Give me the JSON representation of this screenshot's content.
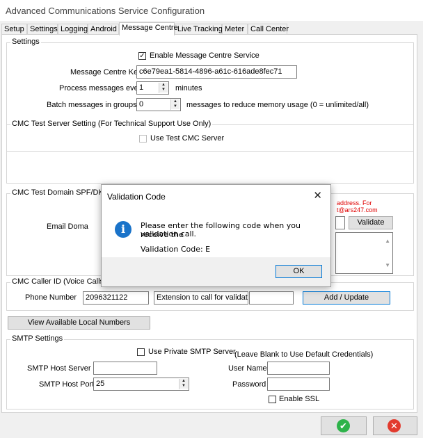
{
  "window": {
    "title": "Advanced Communications Service Configuration"
  },
  "tabs": [
    "Setup",
    "Settings",
    "Logging",
    "Android",
    "Message Centre",
    "Live Tracking",
    "Meter",
    "Call Center"
  ],
  "settings": {
    "title": "Settings",
    "enable_label": "Enable Message Centre Service",
    "enable_checked": true,
    "key_label": "Message Centre Key",
    "key_value": "c6e79ea1-5814-4896-a61c-616ade8fec71",
    "process_label": "Process messages every",
    "process_value": "1",
    "process_unit": "minutes",
    "batch_label": "Batch messages in groups of",
    "batch_value": "0",
    "batch_hint": "messages to reduce memory usage (0 = unlimited/all)"
  },
  "cmc_test_server": {
    "title": "CMC Test Server Setting (For Technical Support Use Only)",
    "use_test_label": "Use Test CMC Server"
  },
  "cmc_domain": {
    "title": "CMC Test Domain SPF/DKIM",
    "email_label": "Email Doma",
    "warn_line1": "address. For",
    "warn_line2": "t@ars247.com",
    "validate_label": "Validate"
  },
  "caller_id": {
    "title": "CMC Caller ID (Voice Calls Onl",
    "phone_label": "Phone Number",
    "phone_value": "2096321122",
    "extension_label": "Extension to call for validation",
    "add_update_label": "Add / Update"
  },
  "view_numbers_label": "View Available Local Numbers",
  "smtp": {
    "title": "SMTP Settings",
    "private_label": "Use Private SMTP Server",
    "leave_blank": "(Leave Blank to Use Default Credentials)",
    "host_label": "SMTP Host Server",
    "port_label": "SMTP Host Port",
    "port_value": "25",
    "user_label": "User Name",
    "password_label": "Password",
    "ssl_label": "Enable SSL"
  },
  "dialog": {
    "title": "Validation Code",
    "message_line1": "Please enter the following code when you receive the",
    "message_line2": "validation call.",
    "code_line": "Validation Code: E",
    "ok_label": "OK"
  },
  "icons": {
    "ok": "check-circle-icon",
    "cancel": "x-circle-icon",
    "info": "info-icon",
    "close": "close-icon"
  },
  "colors": {
    "accent_blue": "#0078d7",
    "ok_green": "#2db34a",
    "cancel_red": "#e23b2e",
    "warning_red": "#e00000"
  }
}
